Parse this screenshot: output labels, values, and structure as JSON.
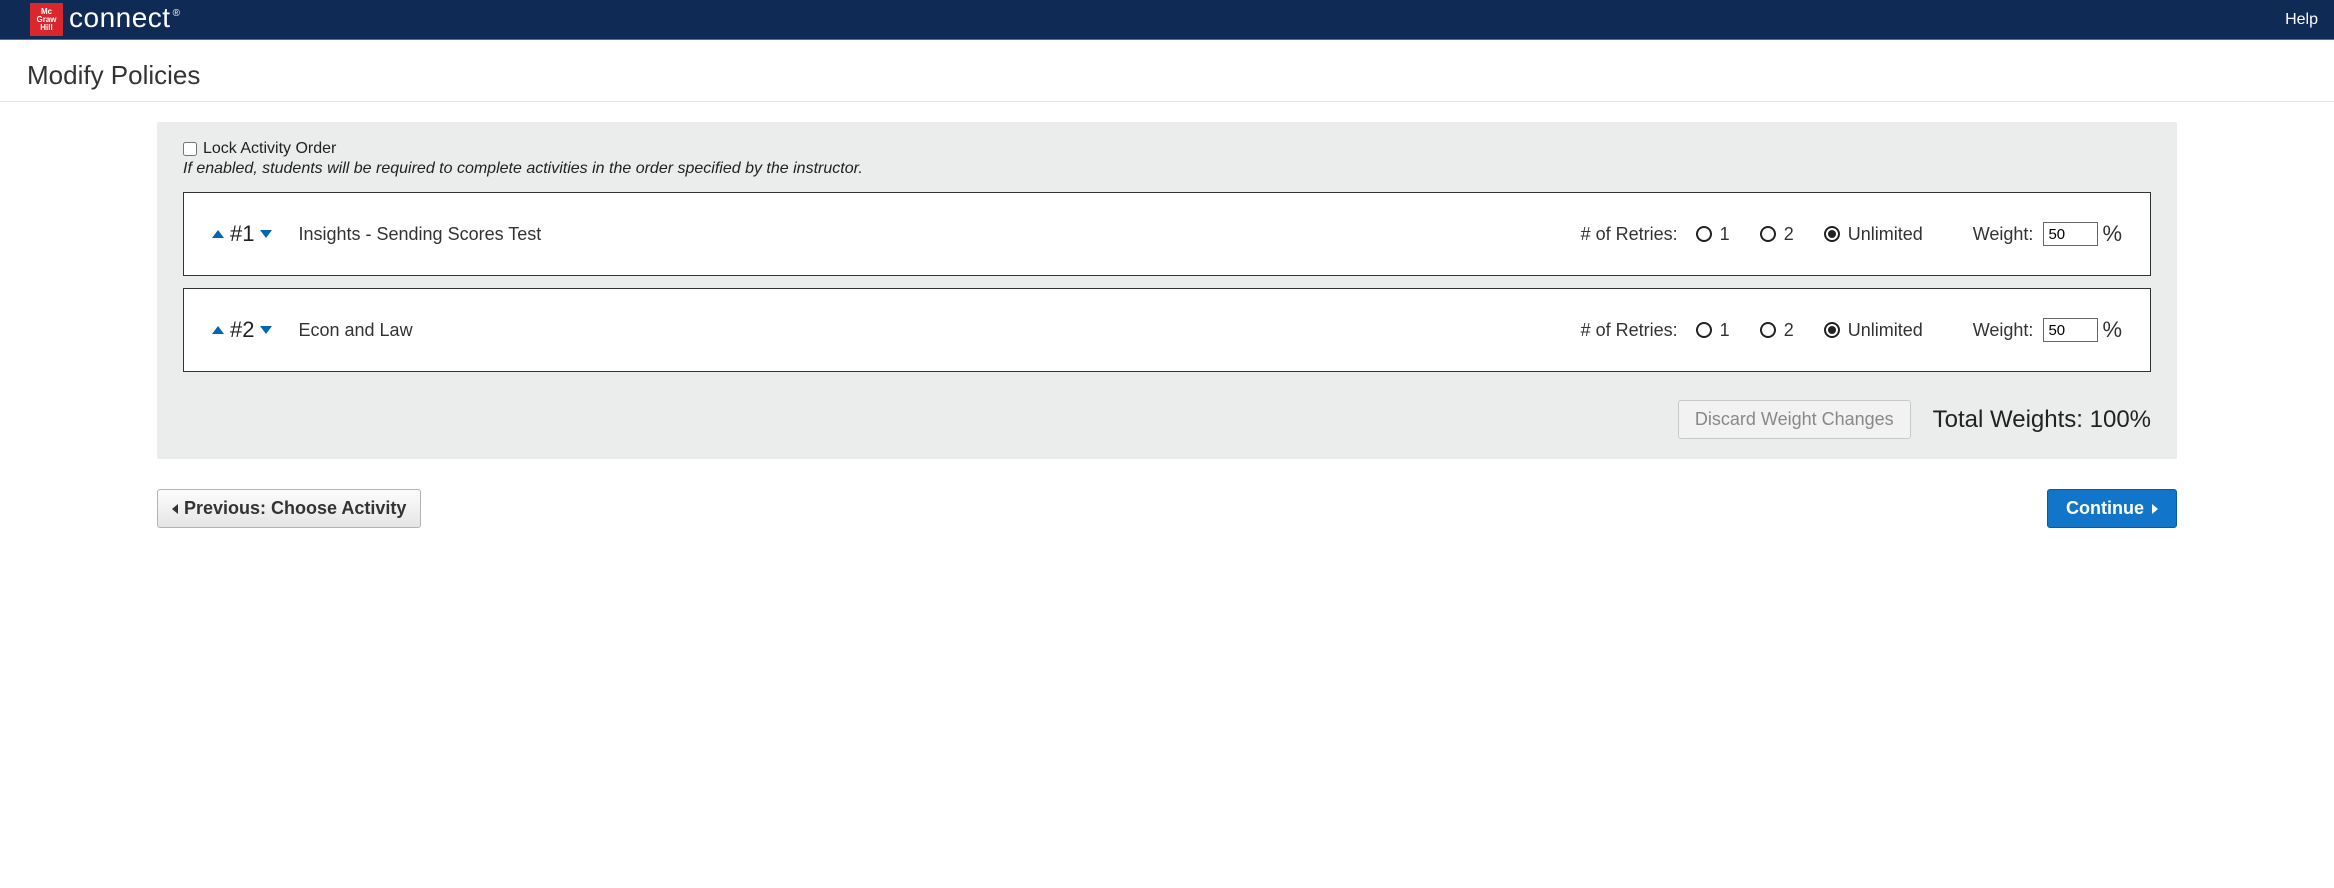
{
  "header": {
    "brand_logo_lines": [
      "Mc",
      "Graw",
      "Hill"
    ],
    "brand_name": "connect",
    "brand_reg": "®",
    "help": "Help"
  },
  "page_title": "Modify Policies",
  "panel": {
    "lock_label": "Lock Activity Order",
    "lock_hint": "If enabled, students will be required to complete activities in the order specified by the instructor.",
    "retries_label": "# of Retries:",
    "weight_label": "Weight:",
    "percent": "%",
    "radio_options": {
      "opt1": "1",
      "opt2": "2",
      "opt_unl": "Unlimited"
    },
    "activities": [
      {
        "order": "#1",
        "title": "Insights - Sending Scores Test",
        "selected_retries": "unlimited",
        "weight": "50"
      },
      {
        "order": "#2",
        "title": "Econ and Law",
        "selected_retries": "unlimited",
        "weight": "50"
      }
    ],
    "discard_label": "Discard Weight Changes",
    "total_weights_label": "Total Weights: 100%"
  },
  "actions": {
    "previous": "Previous: Choose Activity",
    "continue": "Continue"
  }
}
